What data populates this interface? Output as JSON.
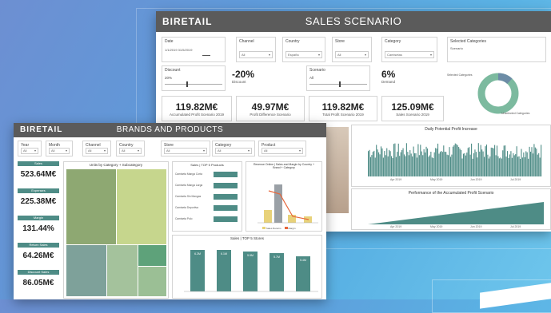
{
  "sales": {
    "brand": "BIRETAIL",
    "title": "SALES SCENARIO",
    "filters": [
      {
        "label": "Date",
        "value": "1/1/2019    31/5/2019"
      },
      {
        "label": "Channel",
        "value": "All"
      },
      {
        "label": "Country",
        "value": "España"
      },
      {
        "label": "Store",
        "value": "All"
      },
      {
        "label": "Category",
        "value": "Camisetas"
      },
      {
        "label": "Selected Categories",
        "value": "Scenario"
      }
    ],
    "discount": {
      "label": "Discount",
      "value": "20%"
    },
    "scenario_pct": {
      "value": "-20%",
      "caption": "Discount"
    },
    "scenario": {
      "label": "Scenario",
      "value": "All"
    },
    "demand": {
      "value": "6%",
      "caption": "Demand"
    },
    "kpis": [
      {
        "value": "119.82M€",
        "caption": "Accumulated Profit Scenario 2019"
      },
      {
        "value": "49.97M€",
        "caption": "Profit Difference Scenario"
      },
      {
        "value": "119.82M€",
        "caption": "Total Profit Scenario 2019"
      },
      {
        "value": "125.09M€",
        "caption": "Sales Scenario 2019"
      }
    ],
    "donut": {
      "label_a": "Selected Categories",
      "label_b": "Unselected Categories",
      "share_selected": 0.12,
      "color_selected": "#6c8ca6",
      "color_rest": "#7cba9f"
    },
    "daily_chart": {
      "title": "Daily Potential Profit Increase",
      "ticks": [
        "Apr 2019",
        "May 2019",
        "Jun 2019",
        "Jul 2019"
      ]
    },
    "perf_chart": {
      "title": "Performance of the Accumulated Profit Scenario",
      "ticks": [
        "Apr 2019",
        "May 2019",
        "Jun 2019",
        "Jul 2019"
      ]
    }
  },
  "brands": {
    "brand": "BIRETAIL",
    "title": "BRANDS AND PRODUCTS",
    "filters": [
      {
        "label": "Year",
        "value": "All"
      },
      {
        "label": "Month",
        "value": "All"
      },
      {
        "label": "Channel",
        "value": "All"
      },
      {
        "label": "Country",
        "value": "All"
      },
      {
        "label": "Store",
        "value": "All"
      },
      {
        "label": "Category",
        "value": "All"
      },
      {
        "label": "Product",
        "value": "All"
      }
    ],
    "kpis": [
      {
        "label": "Sales",
        "value": "523.64M€"
      },
      {
        "label": "Expenses",
        "value": "225.38M€"
      },
      {
        "label": "Margin",
        "value": "131.44%"
      },
      {
        "label": "Return Sales",
        "value": "64.26M€"
      },
      {
        "label": "Discount Sales",
        "value": "86.05M€"
      }
    ],
    "treemap_title": "Units by Category + Subcategory",
    "top5_products_title": "Sales | TOP 5 Products",
    "top5_rows": [
      "Camiseta Manga Corta",
      "Camiseta Manga Larga",
      "Camiseta Sin Mangas",
      "Camiseta Deportiva",
      "Camiseta Polo"
    ],
    "combo_title": "Revenue Online | Sales and Margin by Country + Brand + Category",
    "combo_legend": [
      "Sales Returns",
      "Margin"
    ],
    "bottom_title": "Sales | TOP 5 Stores",
    "bottom_values": [
      "6.2M",
      "6.1M",
      "5.9M",
      "5.7M",
      "5.4M"
    ],
    "accent": "#4e8c86"
  }
}
